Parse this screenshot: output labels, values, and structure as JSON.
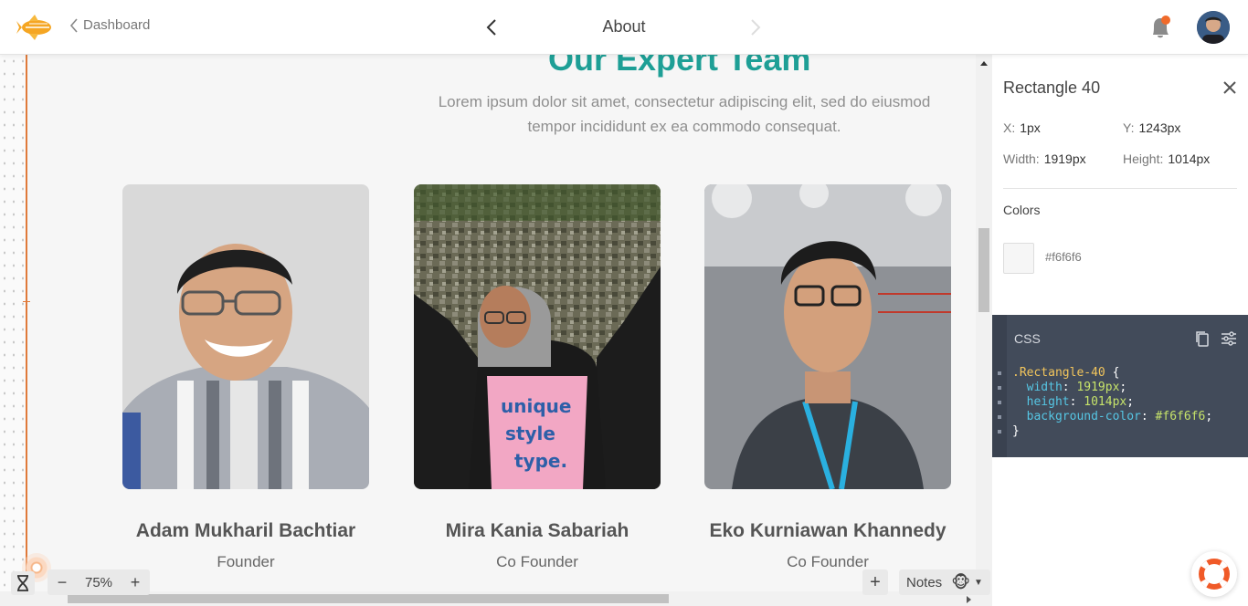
{
  "topbar": {
    "back_label": "Dashboard",
    "screen_title": "About"
  },
  "canvas": {
    "section_title": "Our Expert Team",
    "lead": "Lorem ipsum dolor sit amet, consectetur adipiscing elit, sed do eiusmod tempor incididunt  ex ea commodo consequat.",
    "members": [
      {
        "name": "Adam Mukharil Bachtiar",
        "role": "Founder"
      },
      {
        "name": "Mira Kania Sabariah",
        "role": "Co Founder"
      },
      {
        "name": "Eko Kurniawan Khannedy",
        "role": "Co Founder"
      }
    ],
    "zoom_level": "75%",
    "zoom_minus": "−",
    "zoom_plus": "+",
    "add_label": "+",
    "notes_label": "Notes"
  },
  "inspector": {
    "title": "Rectangle 40",
    "x_label": "X:",
    "x_value": "1px",
    "y_label": "Y:",
    "y_value": "1243px",
    "width_label": "Width:",
    "width_value": "1919px",
    "height_label": "Height:",
    "height_value": "1014px",
    "colors_label": "Colors",
    "color_hex": "#f6f6f6",
    "css_label": "CSS",
    "css": {
      "selector": ".Rectangle-40",
      "open": " {",
      "width_prop": "width",
      "width_val": "1919px",
      "height_prop": "height",
      "height_val": "1014px",
      "bg_prop": "background-color",
      "bg_val": "#f6f6f6",
      "close": "}"
    }
  },
  "colors": {
    "accent_teal": "#1e9f96",
    "canvas_bg": "#f6f6f6",
    "guide_orange": "#e07a3a",
    "css_panel_bg": "#424b5a"
  },
  "icons": [
    "app-logo-icon",
    "chevron-left-icon",
    "chevron-right-icon",
    "bell-icon",
    "close-icon",
    "copy-icon",
    "settings-sliders-icon",
    "hourglass-icon",
    "lifebuoy-icon",
    "monkey-icon"
  ]
}
